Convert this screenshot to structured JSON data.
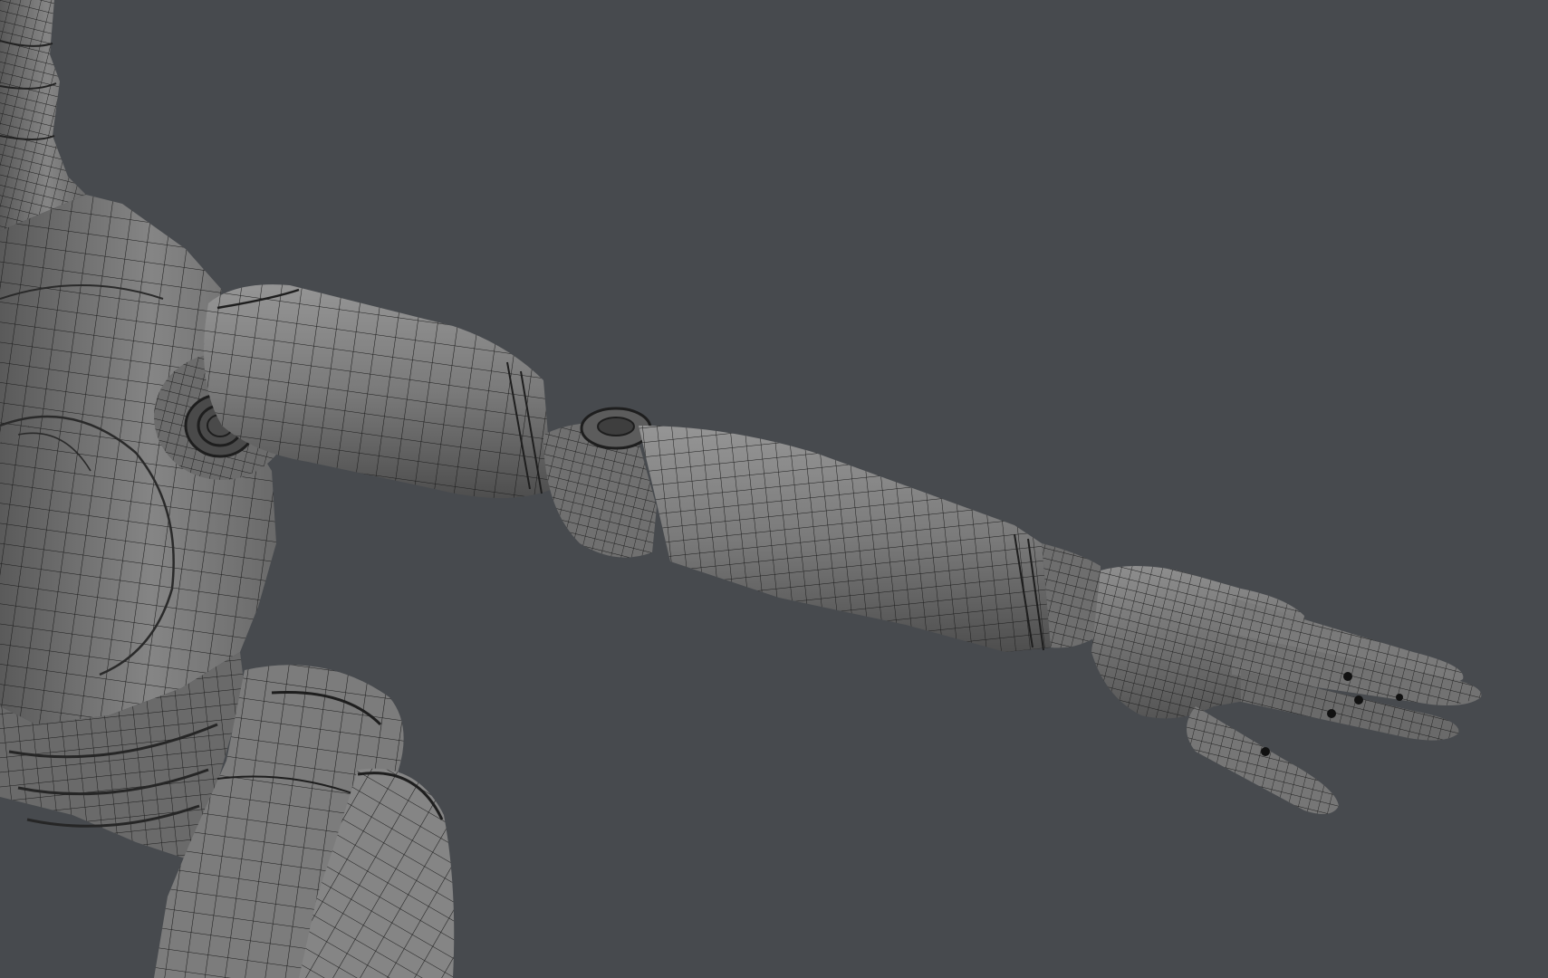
{
  "viewport": {
    "background": "#474a4e",
    "mesh_fill": "#6e6e6e",
    "mesh_fill_light": "#8a8a8a",
    "mesh_fill_dark": "#3c3c3c",
    "wire_color": "#1c1c1c",
    "shading": "wireframe-on-shaded",
    "subject": "robot-figure-outstretched-arm"
  }
}
